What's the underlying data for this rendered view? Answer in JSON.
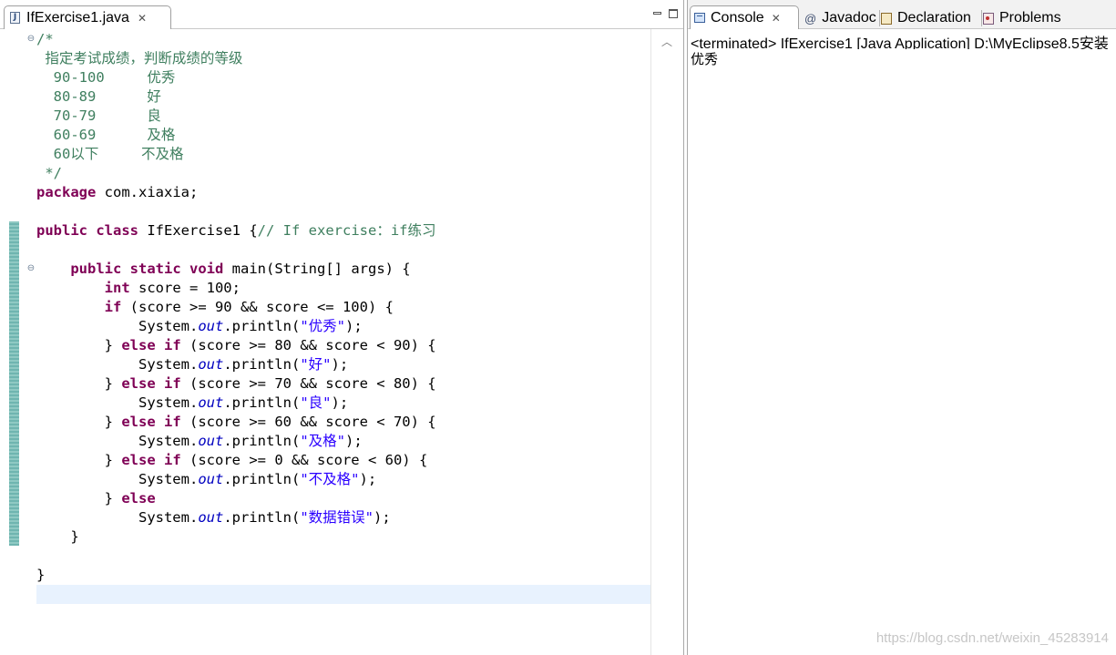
{
  "editor": {
    "tab_label": "IfExercise1.java",
    "tab_icon": "java-file-icon",
    "code_lines": [
      [
        {
          "t": "/*",
          "c": "cm"
        }
      ],
      [
        {
          "t": " 指定考试成绩，判断成绩的等级",
          "c": "cm"
        }
      ],
      [
        {
          "t": "  90-100     优秀",
          "c": "cm"
        }
      ],
      [
        {
          "t": "  80-89      好",
          "c": "cm"
        }
      ],
      [
        {
          "t": "  70-79      良",
          "c": "cm"
        }
      ],
      [
        {
          "t": "  60-69      及格",
          "c": "cm"
        }
      ],
      [
        {
          "t": "  60以下     不及格",
          "c": "cm"
        }
      ],
      [
        {
          "t": " */",
          "c": "cm"
        }
      ],
      [
        {
          "t": "package",
          "c": "kw"
        },
        {
          "t": " com.xiaxia;"
        }
      ],
      [],
      [
        {
          "t": "public",
          "c": "kw"
        },
        {
          "t": " "
        },
        {
          "t": "class",
          "c": "kw"
        },
        {
          "t": " IfExercise1 {"
        },
        {
          "t": "// If exercise：if练习",
          "c": "cm"
        }
      ],
      [],
      [
        {
          "t": "    "
        },
        {
          "t": "public",
          "c": "kw"
        },
        {
          "t": " "
        },
        {
          "t": "static",
          "c": "kw"
        },
        {
          "t": " "
        },
        {
          "t": "void",
          "c": "kw"
        },
        {
          "t": " main(String[] args) {"
        }
      ],
      [
        {
          "t": "        "
        },
        {
          "t": "int",
          "c": "kw"
        },
        {
          "t": " score = 100;"
        }
      ],
      [
        {
          "t": "        "
        },
        {
          "t": "if",
          "c": "kw"
        },
        {
          "t": " (score >= 90 && score <= 100) {"
        }
      ],
      [
        {
          "t": "            System."
        },
        {
          "t": "out",
          "c": "fld"
        },
        {
          "t": ".println("
        },
        {
          "t": "\"优秀\"",
          "c": "st"
        },
        {
          "t": ");"
        }
      ],
      [
        {
          "t": "        } "
        },
        {
          "t": "else",
          "c": "kw"
        },
        {
          "t": " "
        },
        {
          "t": "if",
          "c": "kw"
        },
        {
          "t": " (score >= 80 && score < 90) {"
        }
      ],
      [
        {
          "t": "            System."
        },
        {
          "t": "out",
          "c": "fld"
        },
        {
          "t": ".println("
        },
        {
          "t": "\"好\"",
          "c": "st"
        },
        {
          "t": ");"
        }
      ],
      [
        {
          "t": "        } "
        },
        {
          "t": "else",
          "c": "kw"
        },
        {
          "t": " "
        },
        {
          "t": "if",
          "c": "kw"
        },
        {
          "t": " (score >= 70 && score < 80) {"
        }
      ],
      [
        {
          "t": "            System."
        },
        {
          "t": "out",
          "c": "fld"
        },
        {
          "t": ".println("
        },
        {
          "t": "\"良\"",
          "c": "st"
        },
        {
          "t": ");"
        }
      ],
      [
        {
          "t": "        } "
        },
        {
          "t": "else",
          "c": "kw"
        },
        {
          "t": " "
        },
        {
          "t": "if",
          "c": "kw"
        },
        {
          "t": " (score >= 60 && score < 70) {"
        }
      ],
      [
        {
          "t": "            System."
        },
        {
          "t": "out",
          "c": "fld"
        },
        {
          "t": ".println("
        },
        {
          "t": "\"及格\"",
          "c": "st"
        },
        {
          "t": ");"
        }
      ],
      [
        {
          "t": "        } "
        },
        {
          "t": "else",
          "c": "kw"
        },
        {
          "t": " "
        },
        {
          "t": "if",
          "c": "kw"
        },
        {
          "t": " (score >= 0 && score < 60) {"
        }
      ],
      [
        {
          "t": "            System."
        },
        {
          "t": "out",
          "c": "fld"
        },
        {
          "t": ".println("
        },
        {
          "t": "\"不及格\"",
          "c": "st"
        },
        {
          "t": ");"
        }
      ],
      [
        {
          "t": "        } "
        },
        {
          "t": "else",
          "c": "kw"
        }
      ],
      [
        {
          "t": "            System."
        },
        {
          "t": "out",
          "c": "fld"
        },
        {
          "t": ".println("
        },
        {
          "t": "\"数据错误\"",
          "c": "st"
        },
        {
          "t": ");"
        }
      ],
      [
        {
          "t": "    }"
        }
      ],
      [],
      [
        {
          "t": "}"
        }
      ],
      []
    ],
    "colors": {
      "keyword": "#7f0055",
      "comment": "#3f7f5f",
      "string": "#2a00ff",
      "static_field": "#0000c0",
      "current_line_highlight": "#e8f2fe",
      "change_bar": "#6fb5b0"
    }
  },
  "console": {
    "tabs": [
      {
        "label": "Console",
        "icon": "console-icon",
        "active": true
      },
      {
        "label": "Javadoc",
        "icon": "javadoc-at-icon",
        "active": false
      },
      {
        "label": "Declaration",
        "icon": "declaration-icon",
        "active": false
      },
      {
        "label": "Problems",
        "icon": "problems-icon",
        "active": false
      }
    ],
    "header": "<terminated> IfExercise1 [Java Application] D:\\MyEclipse8.5安装",
    "output": "优秀"
  },
  "watermark": "https://blog.csdn.net/weixin_45283914"
}
